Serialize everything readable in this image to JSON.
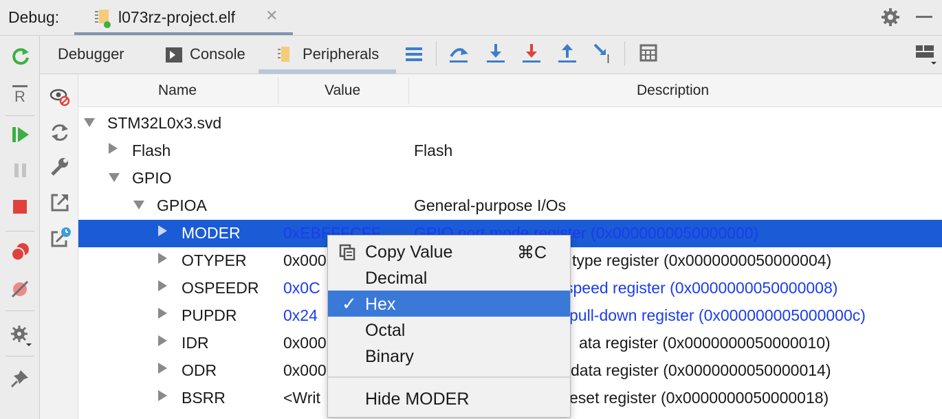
{
  "header": {
    "debug_label": "Debug:",
    "file_tab": "l073rz-project.elf",
    "close_glyph": "✕"
  },
  "subtabs": {
    "debugger": "Debugger",
    "console": "Console",
    "peripherals": "Peripherals"
  },
  "columns": {
    "name": "Name",
    "value": "Value",
    "description": "Description"
  },
  "tree": {
    "root": "STM32L0x3.svd",
    "flash": {
      "name": "Flash",
      "desc": "Flash"
    },
    "gpio": "GPIO",
    "gpioa": {
      "name": "GPIOA",
      "desc": "General-purpose I/Os"
    },
    "registers": [
      {
        "name": "MODER",
        "value": "0xEBFFFCFF",
        "desc": "GPIO port mode register (0x0000000050000000)"
      },
      {
        "name": "OTYPER",
        "value": "0x000",
        "desc": "type register (0x0000000050000004)"
      },
      {
        "name": "OSPEEDR",
        "value": "0x0C",
        "desc": "speed register (0x0000000050000008)"
      },
      {
        "name": "PUPDR",
        "value": "0x24",
        "desc": "pull-down register (0x000000005000000c)"
      },
      {
        "name": "IDR",
        "value": "0x000",
        "desc": "ata register (0x0000000050000010)"
      },
      {
        "name": "ODR",
        "value": "0x000",
        "desc": "data register (0x0000000050000014)"
      },
      {
        "name": "BSRR",
        "value": "<Writ",
        "desc": "eset register (0x0000000050000018)"
      }
    ]
  },
  "context_menu": {
    "copy_value": "Copy Value",
    "copy_shortcut": "⌘C",
    "decimal": "Decimal",
    "hex": "Hex",
    "octal": "Octal",
    "binary": "Binary",
    "hide": "Hide MODER",
    "check": "✓"
  },
  "colors": {
    "selection": "#1b5bd6",
    "menu_highlight": "#3a79d8",
    "changed_value": "#1a3cf0"
  }
}
